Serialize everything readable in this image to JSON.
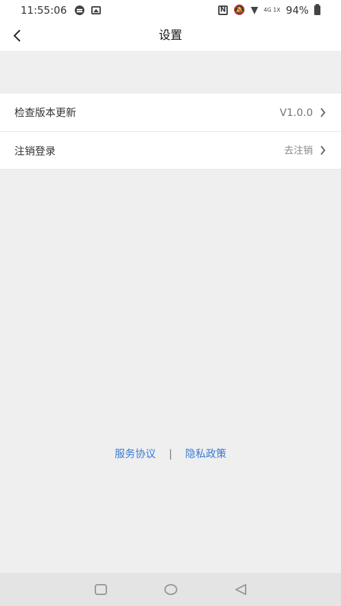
{
  "status_bar": {
    "time": "11:55:06",
    "network_label": "4G 1X",
    "battery_percent": "94%",
    "icons": [
      "message-icon",
      "image-icon",
      "nfc-icon",
      "mute-icon",
      "wifi-icon",
      "network-signal-icon",
      "battery-icon"
    ]
  },
  "header": {
    "title": "设置",
    "back_icon": "chevron-left-icon"
  },
  "settings": {
    "items": [
      {
        "label": "检查版本更新",
        "value": "V1.0.0"
      },
      {
        "label": "注销登录",
        "value": "去注销"
      }
    ]
  },
  "footer": {
    "service_agreement": "服务协议",
    "separator": "|",
    "privacy_policy": "隐私政策"
  },
  "navigation_bar": {
    "icons": [
      "recent-apps-icon",
      "home-icon",
      "back-icon"
    ]
  },
  "colors": {
    "background": "#efefef",
    "link": "#3a7ad6"
  }
}
